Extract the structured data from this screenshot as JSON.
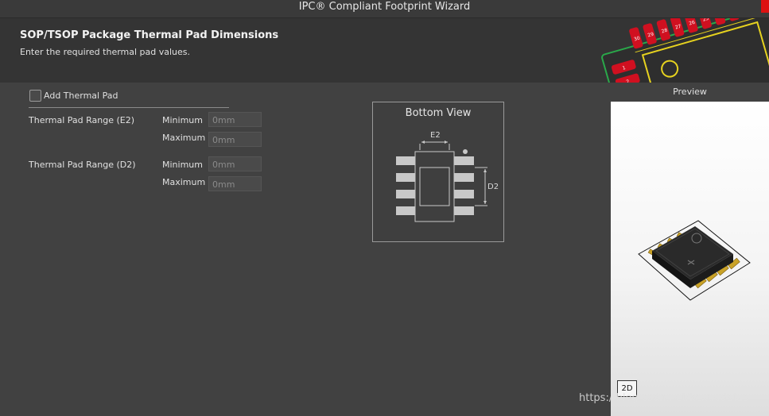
{
  "window": {
    "title": "IPC® Compliant Footprint Wizard"
  },
  "header": {
    "title": "SOP/TSOP Package Thermal Pad Dimensions",
    "subtitle": "Enter the required thermal pad values."
  },
  "form": {
    "add_thermal_pad_label": "Add Thermal Pad",
    "add_thermal_pad_checked": false,
    "ranges": [
      {
        "label": "Thermal Pad Range (E2)",
        "minimum_label": "Minimum",
        "minimum_value": "0mm",
        "maximum_label": "Maximum",
        "maximum_value": "0mm"
      },
      {
        "label": "Thermal Pad Range (D2)",
        "minimum_label": "Minimum",
        "minimum_value": "0mm",
        "maximum_label": "Maximum",
        "maximum_value": "0mm"
      }
    ]
  },
  "bottom_view": {
    "title": "Bottom View",
    "e2_label": "E2",
    "d2_label": "D2"
  },
  "preview": {
    "label": "Preview",
    "toggle_label": "2D"
  },
  "watermark": "https://blog.csdn.net/kexuedalao",
  "colors": {
    "background": "#414141",
    "header": "#343434",
    "pad_red": "#d01020",
    "pcb_green": "#2aa84a",
    "pin_gold": "#c9a227"
  }
}
